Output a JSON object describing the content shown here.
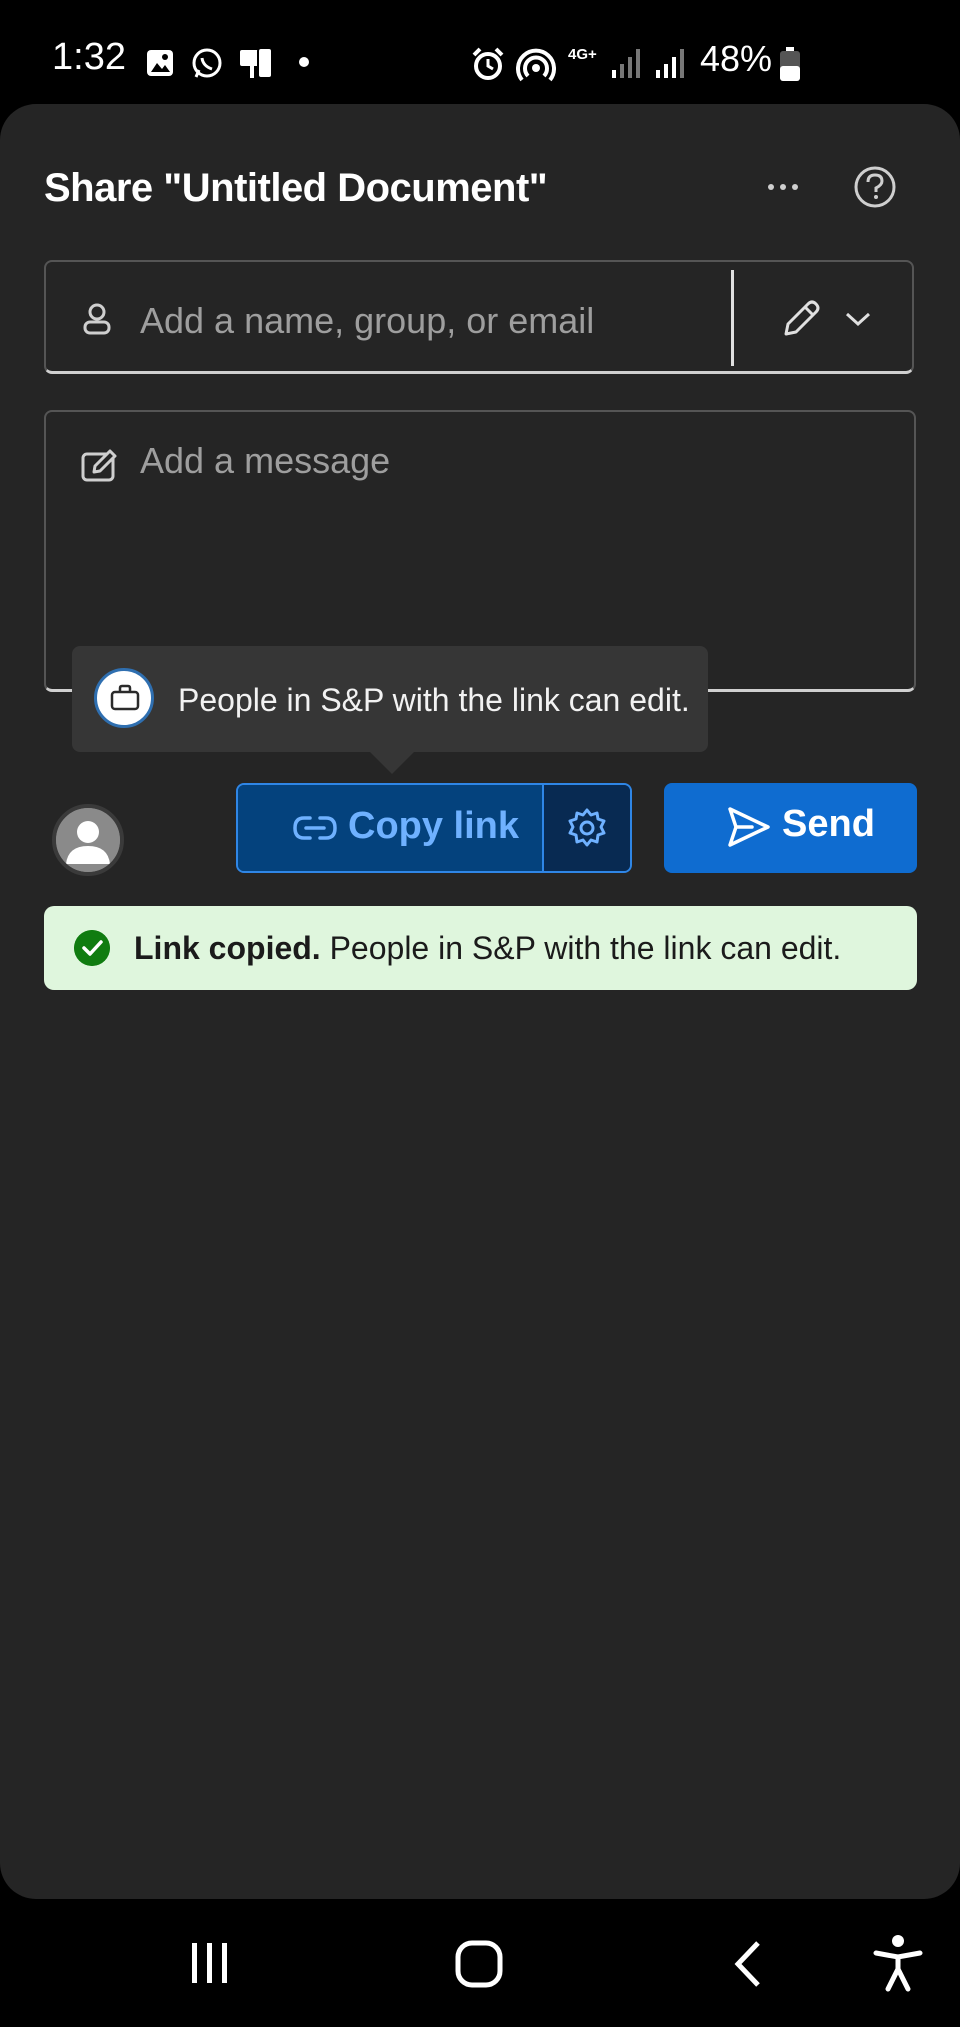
{
  "status_bar": {
    "time": "1:32",
    "battery": "48%",
    "network": "4G+",
    "icons": [
      "image-icon",
      "whatsapp-icon",
      "screen-mirror-icon",
      "dot-icon",
      "alarm-icon",
      "hotspot-icon",
      "signal-icon",
      "signal-icon",
      "battery-icon"
    ]
  },
  "dialog": {
    "title": "Share \"Untitled Document\"",
    "more_icon": "more-icon",
    "help_icon": "help-icon"
  },
  "people_field": {
    "placeholder": "Add a name, group, or email",
    "person_icon": "person-icon",
    "permission_icon": "pencil-icon",
    "dropdown_icon": "chevron-down-icon"
  },
  "message_field": {
    "placeholder": "Add a message",
    "icon": "edit-note-icon"
  },
  "tooltip": {
    "text": "People in S&P with the link can edit.",
    "icon": "briefcase-icon"
  },
  "actions": {
    "copy_link_label": "Copy link",
    "copy_link_icon": "link-icon",
    "settings_icon": "gear-icon",
    "send_label": "Send",
    "send_icon": "send-icon",
    "avatar_icon": "avatar-icon"
  },
  "toast": {
    "bold": "Link copied.",
    "text": " People in S&P with the link can edit.",
    "icon": "checkmark-circle-icon"
  },
  "nav_bar": {
    "icons": [
      "recents-icon",
      "home-icon",
      "back-icon",
      "accessibility-icon"
    ]
  },
  "colors": {
    "sheet_bg": "#252525",
    "accent": "#0f6cd0",
    "copy_bg": "#04427d",
    "copy_text": "#6fb1ff",
    "toast_bg": "#dff6dd",
    "success": "#107c10"
  }
}
